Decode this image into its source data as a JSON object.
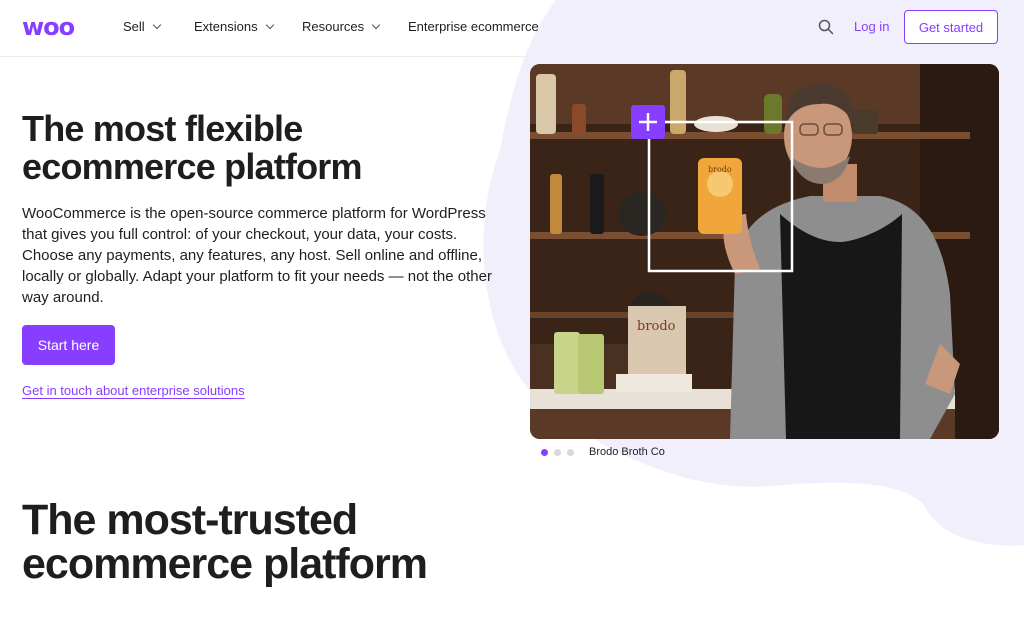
{
  "header": {
    "logo": "woo",
    "nav": [
      {
        "label": "Sell",
        "has_dropdown": true
      },
      {
        "label": "Extensions",
        "has_dropdown": true
      },
      {
        "label": "Resources",
        "has_dropdown": true
      },
      {
        "label": "Enterprise ecommerce",
        "has_dropdown": false
      }
    ],
    "search_icon": "search-icon",
    "login": "Log in",
    "cta": "Get started"
  },
  "hero": {
    "title_line1": "The most flexible",
    "title_line2": "ecommerce platform",
    "description": "WooCommerce is the open-source commerce platform for WordPress that gives you full control: of your checkout, your data, your costs. Choose any payments, any features, any host. Sell online and offline, locally or globally. Adapt your platform to fit your needs — not the other way around.",
    "primary_button": "Start here",
    "enterprise_link": "Get in touch about enterprise solutions",
    "carousel": {
      "active_index": 0,
      "count": 3,
      "caption": "Brodo Broth Co"
    },
    "image_labels": {
      "product_box": "brodo",
      "bag": "brodo"
    }
  },
  "section": {
    "title_line1": "The most-trusted",
    "title_line2": "ecommerce platform"
  },
  "colors": {
    "brand": "#873eff",
    "blob": "#f2effd",
    "text": "#1e1e1e"
  }
}
